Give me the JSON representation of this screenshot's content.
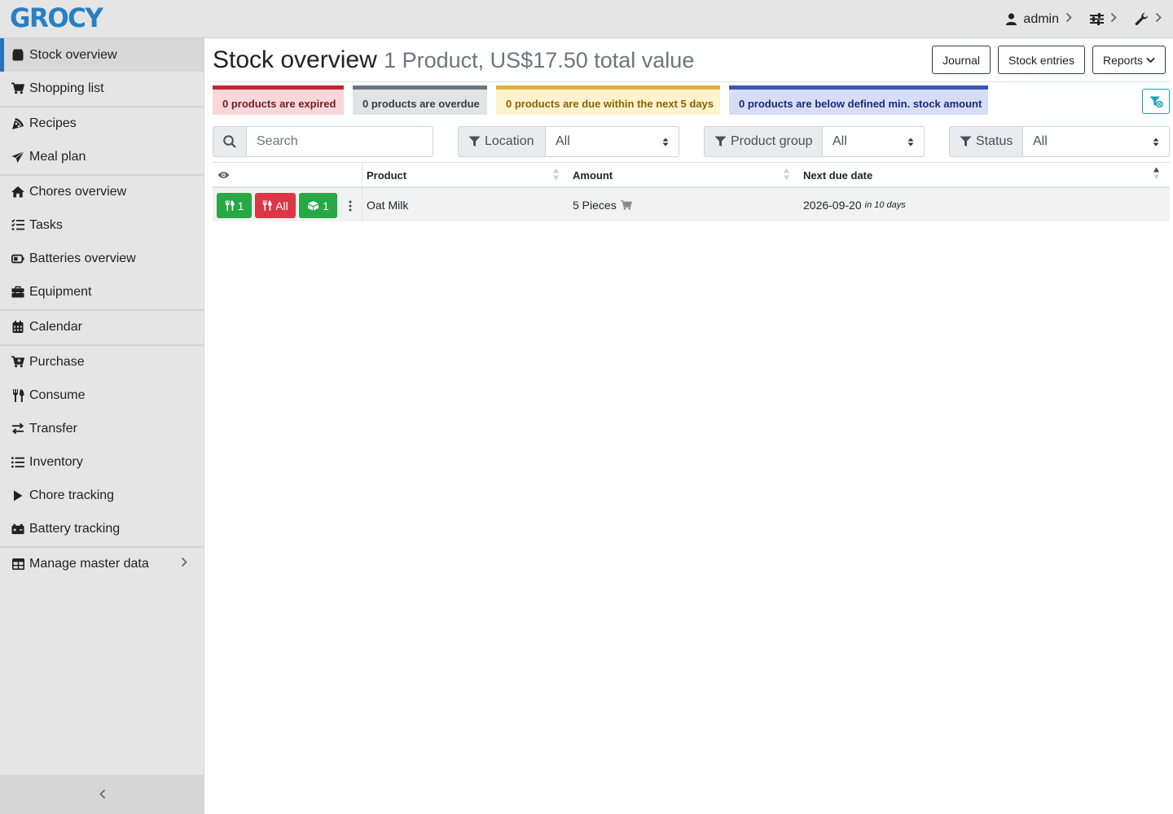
{
  "app": {
    "logo": "GROCY"
  },
  "topbar": {
    "user": "admin"
  },
  "sidebar": {
    "items": [
      {
        "label": "Stock overview"
      },
      {
        "label": "Shopping list"
      },
      {
        "label": "Recipes"
      },
      {
        "label": "Meal plan"
      },
      {
        "label": "Chores overview"
      },
      {
        "label": "Tasks"
      },
      {
        "label": "Batteries overview"
      },
      {
        "label": "Equipment"
      },
      {
        "label": "Calendar"
      },
      {
        "label": "Purchase"
      },
      {
        "label": "Consume"
      },
      {
        "label": "Transfer"
      },
      {
        "label": "Inventory"
      },
      {
        "label": "Chore tracking"
      },
      {
        "label": "Battery tracking"
      },
      {
        "label": "Manage master data"
      }
    ],
    "active": "Stock overview"
  },
  "header": {
    "title": "Stock overview",
    "subtitle": "1 Product, US$17.50 total value",
    "buttons": {
      "journal": "Journal",
      "stock_entries": "Stock entries",
      "reports": "Reports"
    }
  },
  "status_badges": {
    "expired": "0 products are expired",
    "overdue": "0 products are overdue",
    "due_soon": "0 products are due within the next 5 days",
    "below_min": "0 products are below defined min. stock amount"
  },
  "filters": {
    "search_placeholder": "Search",
    "location": {
      "label": "Location",
      "value": "All"
    },
    "product_group": {
      "label": "Product group",
      "value": "All"
    },
    "status": {
      "label": "Status",
      "value": "All"
    }
  },
  "table": {
    "columns": {
      "product": "Product",
      "amount": "Amount",
      "next_due": "Next due date"
    },
    "rows": [
      {
        "consume_one": "1",
        "consume_all": "All",
        "open_one": "1",
        "product": "Oat Milk",
        "amount": "5 Pieces",
        "next_due_date": "2026-09-20",
        "next_due_relative": "in 10 days"
      }
    ]
  },
  "colors": {
    "brand": "#2a7fc4",
    "accent": "#2a72b8",
    "danger": "#dc3545",
    "success": "#28a745",
    "warning": "#e0b03a",
    "info": "#17a2b8"
  }
}
